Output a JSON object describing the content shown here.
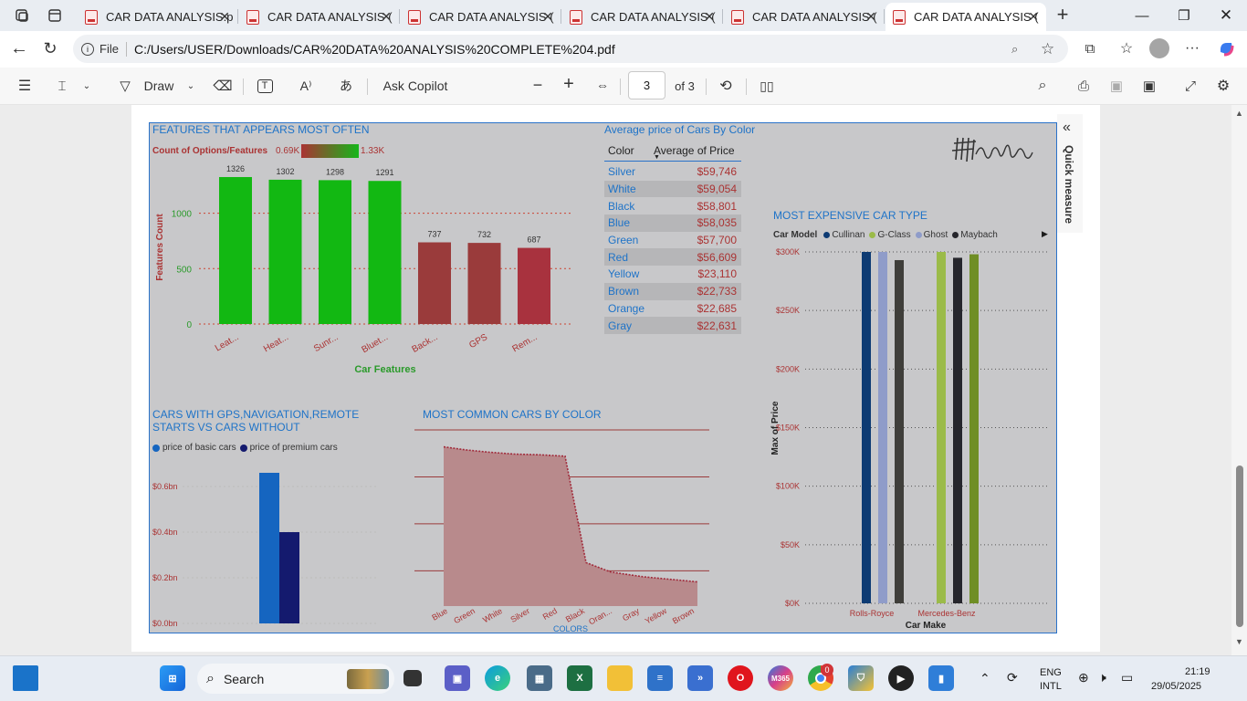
{
  "browser": {
    "tabs": [
      {
        "label": "CAR DATA ANALYSIS.p",
        "left": 85,
        "w": 175
      },
      {
        "label": "CAR DATA ANALYSIS (",
        "left": 262,
        "w": 175
      },
      {
        "label": "CAR DATA ANALYSIS (",
        "left": 439,
        "w": 175
      },
      {
        "label": "CAR DATA ANALYSIS (",
        "left": 616,
        "w": 175
      },
      {
        "label": "CAR DATA ANALYSIS (",
        "left": 793,
        "w": 175
      }
    ],
    "active_tab": "CAR DATA ANALYSIS (",
    "new_tab": "+",
    "file_label": "File",
    "url": "C:/Users/USER/Downloads/CAR%20DATA%20ANALYSIS%20COMPLETE%204.pdf"
  },
  "pdf_toolbar": {
    "draw": "Draw",
    "ask_copilot": "Ask Copilot",
    "page": "3",
    "of": "of 3",
    "zoom_out": "−",
    "zoom_in": "+"
  },
  "report": {
    "features_title": "FEATURES THAT APPEARS MOST OFTEN",
    "legend_label": "Count of Options/Features",
    "legend_min": "0.69K",
    "legend_max": "1.33K",
    "price_title": "Average price of Cars By Color",
    "price_headers": [
      "Color",
      "Average of Price"
    ],
    "price_rows": [
      [
        "Silver",
        "$59,746"
      ],
      [
        "White",
        "$59,054"
      ],
      [
        "Black",
        "$58,801"
      ],
      [
        "Blue",
        "$58,035"
      ],
      [
        "Green",
        "$57,700"
      ],
      [
        "Red",
        "$56,609"
      ],
      [
        "Yellow",
        "$23,110"
      ],
      [
        "Brown",
        "$22,733"
      ],
      [
        "Orange",
        "$22,685"
      ],
      [
        "Gray",
        "$22,631"
      ]
    ],
    "expensive_title": "MOST EXPENSIVE CAR TYPE",
    "gps_title_1": "CARS WITH GPS,NAVIGATION,REMOTE",
    "gps_title_2": "STARTS VS CARS WITHOUT",
    "common_title": "MOST COMMON CARS BY COLOR",
    "quick_measure": "Quick measure"
  },
  "chart_data": [
    {
      "type": "bar",
      "title": "FEATURES THAT APPEARS MOST OFTEN",
      "xlabel": "Car Features",
      "ylabel": "Features Count",
      "categories": [
        "Leat...",
        "Heat...",
        "Sunr...",
        "Bluet...",
        "Back...",
        "GPS",
        "Rem..."
      ],
      "values": [
        1326,
        1302,
        1298,
        1291,
        737,
        732,
        687
      ],
      "colors": [
        "#12b812",
        "#12b812",
        "#12b812",
        "#12b812",
        "#9a3b3b",
        "#9a3b3b",
        "#a8323e"
      ],
      "yticks": [
        "0",
        "500",
        "1000"
      ],
      "ylim": [
        0,
        1400
      ]
    },
    {
      "type": "bar",
      "title": "CARS WITH GPS,NAVIGATION,REMOTE STARTS VS CARS WITHOUT",
      "series": [
        {
          "name": "price of basic cars",
          "values": [
            0.66
          ],
          "color": "#1565c0"
        },
        {
          "name": "price of premium cars",
          "values": [
            0.4
          ],
          "color": "#141a6e"
        }
      ],
      "yticks": [
        "$0.0bn",
        "$0.2bn",
        "$0.4bn",
        "$0.6bn"
      ],
      "ylim": [
        0,
        0.6
      ]
    },
    {
      "type": "area",
      "title": "MOST COMMON CARS BY COLOR",
      "xlabel": "COLORS",
      "categories": [
        "Blue",
        "Green",
        "White",
        "Silver",
        "Red",
        "Black",
        "Oran...",
        "Gray",
        "Yellow",
        "Brown"
      ],
      "values": [
        2528,
        2515,
        2505,
        2497,
        2494,
        2488,
        2035,
        1995,
        1975,
        1953
      ],
      "yticks": [
        "2000",
        "2200",
        "2400",
        "2600"
      ],
      "ylim": [
        1850,
        2600
      ],
      "color": "#b88a8c"
    },
    {
      "type": "bar",
      "title": "MOST EXPENSIVE CAR TYPE",
      "xlabel": "Car Make",
      "ylabel": "Max of Price",
      "legend_title": "Car Model",
      "series": [
        {
          "name": "Cullinan",
          "color": "#0d3b73"
        },
        {
          "name": "G-Class",
          "color": "#9bbb49"
        },
        {
          "name": "Ghost",
          "color": "#8f9cc9"
        },
        {
          "name": "Maybach",
          "color": "#26262c"
        }
      ],
      "categories": [
        "Rolls-Royce",
        "Mercedes-Benz"
      ],
      "bars": [
        {
          "make": "Rolls-Royce",
          "model": "Cullinan",
          "value": 300000,
          "color": "#0d3b73"
        },
        {
          "make": "Rolls-Royce",
          "model": "Ghost",
          "value": 300000,
          "color": "#8f9cc9"
        },
        {
          "make": "Rolls-Royce",
          "model": "",
          "value": 293000,
          "color": "#3f3e3a"
        },
        {
          "make": "Mercedes-Benz",
          "model": "G-Class",
          "value": 300000,
          "color": "#9bbb49"
        },
        {
          "make": "Mercedes-Benz",
          "model": "Maybach",
          "value": 295000,
          "color": "#26262c"
        },
        {
          "make": "Mercedes-Benz",
          "model": "",
          "value": 298000,
          "color": "#6f8e25"
        }
      ],
      "yticks": [
        "$0K",
        "$50K",
        "$100K",
        "$150K",
        "$200K",
        "$250K",
        "$300K"
      ],
      "ylim": [
        0,
        300000
      ]
    }
  ],
  "taskbar": {
    "search": "Search",
    "lang": "ENG",
    "layout": "INTL",
    "time": "21:19",
    "date": "29/05/2025",
    "badge": "0"
  }
}
